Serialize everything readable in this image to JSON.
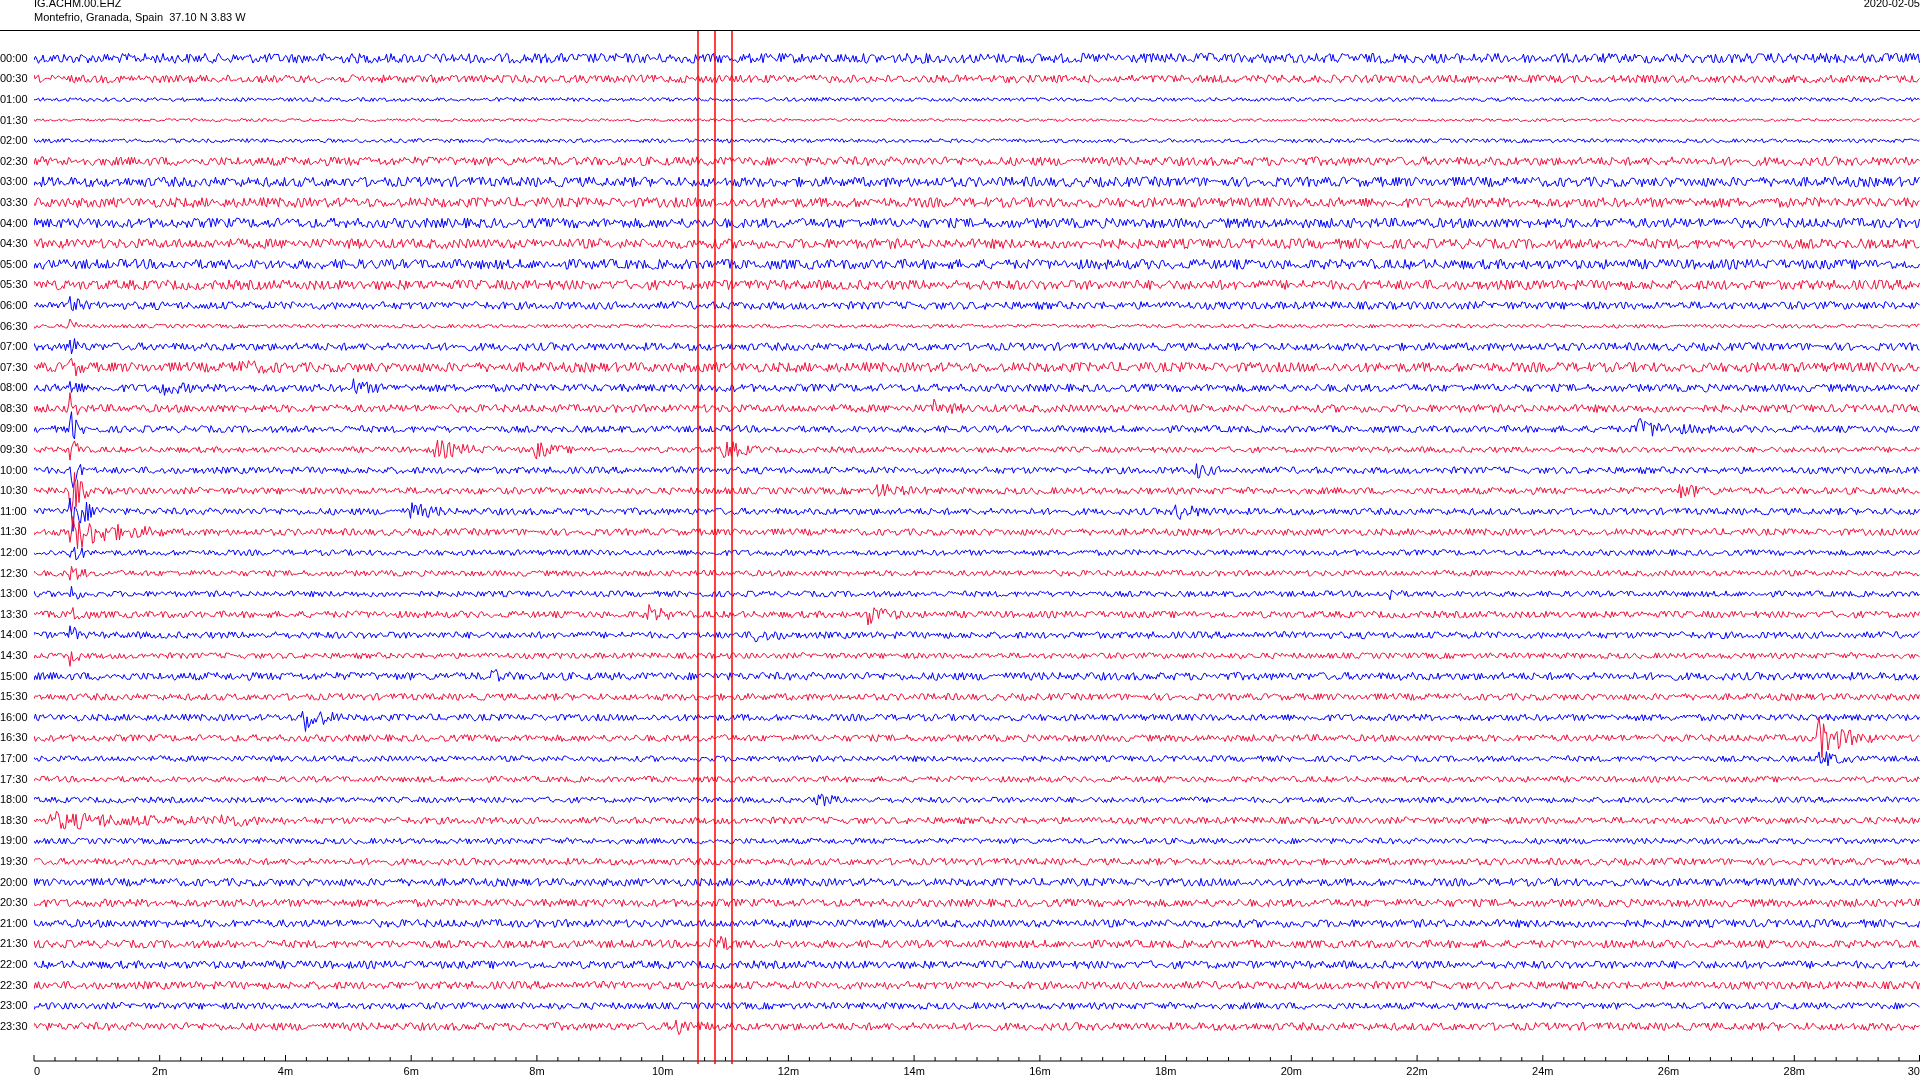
{
  "header": {
    "station": "IG.ACHM.00.EHZ",
    "location": "Montefrio, Granada, Spain  37.10 N 3.83 W",
    "date": "2020-02-05"
  },
  "rows": [
    {
      "time": "00:00",
      "color": "#0000ff"
    },
    {
      "time": "00:30",
      "color": "#f0103a"
    },
    {
      "time": "01:00",
      "color": "#0000ff"
    },
    {
      "time": "01:30",
      "color": "#f0103a"
    },
    {
      "time": "02:00",
      "color": "#0000ff"
    },
    {
      "time": "02:30",
      "color": "#f0103a"
    },
    {
      "time": "03:00",
      "color": "#0000ff"
    },
    {
      "time": "03:30",
      "color": "#f0103a"
    },
    {
      "time": "04:00",
      "color": "#0000ff"
    },
    {
      "time": "04:30",
      "color": "#f0103a"
    },
    {
      "time": "05:00",
      "color": "#0000ff"
    },
    {
      "time": "05:30",
      "color": "#f0103a"
    },
    {
      "time": "06:00",
      "color": "#0000ff"
    },
    {
      "time": "06:30",
      "color": "#f0103a"
    },
    {
      "time": "07:00",
      "color": "#0000ff"
    },
    {
      "time": "07:30",
      "color": "#f0103a"
    },
    {
      "time": "08:00",
      "color": "#0000ff"
    },
    {
      "time": "08:30",
      "color": "#f0103a"
    },
    {
      "time": "09:00",
      "color": "#0000ff"
    },
    {
      "time": "09:30",
      "color": "#f0103a"
    },
    {
      "time": "10:00",
      "color": "#0000ff"
    },
    {
      "time": "10:30",
      "color": "#f0103a"
    },
    {
      "time": "11:00",
      "color": "#0000ff"
    },
    {
      "time": "11:30",
      "color": "#f0103a"
    },
    {
      "time": "12:00",
      "color": "#0000ff"
    },
    {
      "time": "12:30",
      "color": "#f0103a"
    },
    {
      "time": "13:00",
      "color": "#0000ff"
    },
    {
      "time": "13:30",
      "color": "#f0103a"
    },
    {
      "time": "14:00",
      "color": "#0000ff"
    },
    {
      "time": "14:30",
      "color": "#f0103a"
    },
    {
      "time": "15:00",
      "color": "#0000ff"
    },
    {
      "time": "15:30",
      "color": "#f0103a"
    },
    {
      "time": "16:00",
      "color": "#0000ff"
    },
    {
      "time": "16:30",
      "color": "#f0103a"
    },
    {
      "time": "17:00",
      "color": "#0000ff"
    },
    {
      "time": "17:30",
      "color": "#f0103a"
    },
    {
      "time": "18:00",
      "color": "#0000ff"
    },
    {
      "time": "18:30",
      "color": "#f0103a"
    },
    {
      "time": "19:00",
      "color": "#0000ff"
    },
    {
      "time": "19:30",
      "color": "#f0103a"
    },
    {
      "time": "20:00",
      "color": "#0000ff"
    },
    {
      "time": "20:30",
      "color": "#f0103a"
    },
    {
      "time": "21:00",
      "color": "#0000ff"
    },
    {
      "time": "21:30",
      "color": "#f0103a"
    },
    {
      "time": "22:00",
      "color": "#0000ff"
    },
    {
      "time": "22:30",
      "color": "#f0103a"
    },
    {
      "time": "23:00",
      "color": "#0000ff"
    },
    {
      "time": "23:30",
      "color": "#f0103a"
    }
  ],
  "x_axis": {
    "labels": [
      "0",
      "2m",
      "4m",
      "6m",
      "8m",
      "10m",
      "12m",
      "14m",
      "16m",
      "18m",
      "20m",
      "22m",
      "24m",
      "26m",
      "28m",
      "30"
    ]
  }
}
